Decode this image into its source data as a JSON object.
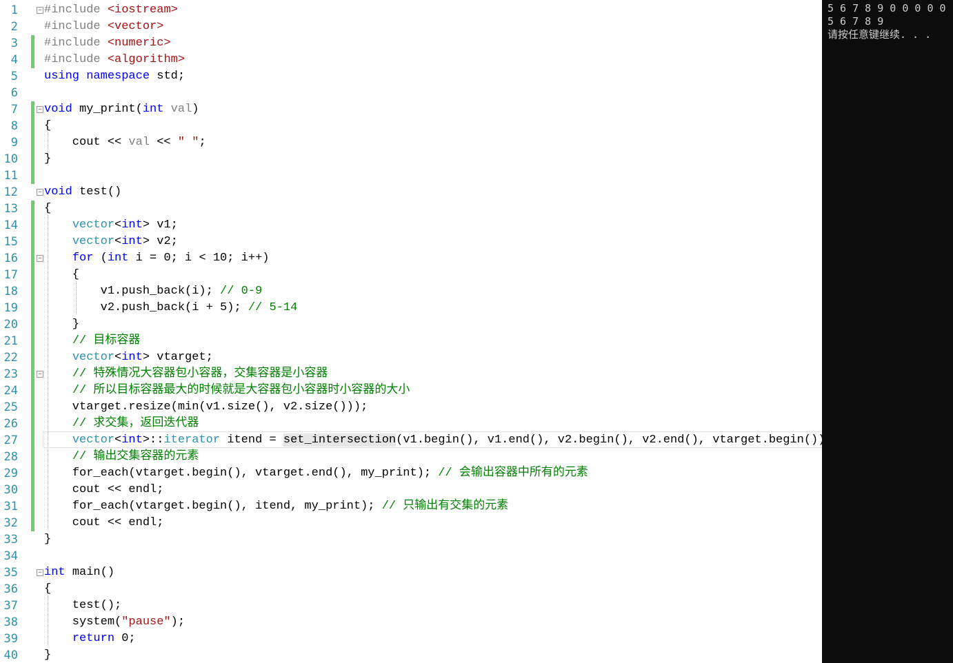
{
  "editor": {
    "lines": [
      {
        "n": "1",
        "s": [
          {
            "t": "#include ",
            "c": "inc"
          },
          {
            "t": "<iostream>",
            "c": "str"
          }
        ]
      },
      {
        "n": "2",
        "s": [
          {
            "t": "#include ",
            "c": "inc"
          },
          {
            "t": "<vector>",
            "c": "str"
          }
        ]
      },
      {
        "n": "3",
        "s": [
          {
            "t": "#include ",
            "c": "inc"
          },
          {
            "t": "<numeric>",
            "c": "str"
          }
        ]
      },
      {
        "n": "4",
        "s": [
          {
            "t": "#include ",
            "c": "inc"
          },
          {
            "t": "<algorithm>",
            "c": "str"
          }
        ]
      },
      {
        "n": "5",
        "s": [
          {
            "t": "using ",
            "c": "kw"
          },
          {
            "t": "namespace ",
            "c": "kw"
          },
          {
            "t": "std;",
            "c": ""
          }
        ]
      },
      {
        "n": "6",
        "s": []
      },
      {
        "n": "7",
        "s": [
          {
            "t": "void ",
            "c": "kw"
          },
          {
            "t": "my_print(",
            "c": ""
          },
          {
            "t": "int ",
            "c": "kw"
          },
          {
            "t": "val",
            "c": "par"
          },
          {
            "t": ")",
            "c": ""
          }
        ]
      },
      {
        "n": "8",
        "s": [
          {
            "t": "{",
            "c": ""
          }
        ]
      },
      {
        "n": "9",
        "s": [
          {
            "t": "    cout << ",
            "c": ""
          },
          {
            "t": "val",
            "c": "par"
          },
          {
            "t": " << ",
            "c": ""
          },
          {
            "t": "\" \"",
            "c": "str"
          },
          {
            "t": ";",
            "c": ""
          }
        ]
      },
      {
        "n": "10",
        "s": [
          {
            "t": "}",
            "c": ""
          }
        ]
      },
      {
        "n": "11",
        "s": []
      },
      {
        "n": "12",
        "s": [
          {
            "t": "void ",
            "c": "kw"
          },
          {
            "t": "test()",
            "c": ""
          }
        ]
      },
      {
        "n": "13",
        "s": [
          {
            "t": "{",
            "c": ""
          }
        ]
      },
      {
        "n": "14",
        "s": [
          {
            "t": "    ",
            "c": ""
          },
          {
            "t": "vector",
            "c": "ty"
          },
          {
            "t": "<",
            "c": ""
          },
          {
            "t": "int",
            "c": "kw"
          },
          {
            "t": "> v1;",
            "c": ""
          }
        ]
      },
      {
        "n": "15",
        "s": [
          {
            "t": "    ",
            "c": ""
          },
          {
            "t": "vector",
            "c": "ty"
          },
          {
            "t": "<",
            "c": ""
          },
          {
            "t": "int",
            "c": "kw"
          },
          {
            "t": "> v2;",
            "c": ""
          }
        ]
      },
      {
        "n": "16",
        "s": [
          {
            "t": "    ",
            "c": ""
          },
          {
            "t": "for ",
            "c": "kw"
          },
          {
            "t": "(",
            "c": ""
          },
          {
            "t": "int ",
            "c": "kw"
          },
          {
            "t": "i = 0; i < 10; i++)",
            "c": ""
          }
        ]
      },
      {
        "n": "17",
        "s": [
          {
            "t": "    {",
            "c": ""
          }
        ]
      },
      {
        "n": "18",
        "s": [
          {
            "t": "        v1.push_back(i); ",
            "c": ""
          },
          {
            "t": "// 0-9",
            "c": "cmt"
          }
        ]
      },
      {
        "n": "19",
        "s": [
          {
            "t": "        v2.push_back(i + 5); ",
            "c": ""
          },
          {
            "t": "// 5-14",
            "c": "cmt"
          }
        ]
      },
      {
        "n": "20",
        "s": [
          {
            "t": "    }",
            "c": ""
          }
        ]
      },
      {
        "n": "21",
        "s": [
          {
            "t": "    ",
            "c": ""
          },
          {
            "t": "// 目标容器",
            "c": "cmt"
          }
        ]
      },
      {
        "n": "22",
        "s": [
          {
            "t": "    ",
            "c": ""
          },
          {
            "t": "vector",
            "c": "ty"
          },
          {
            "t": "<",
            "c": ""
          },
          {
            "t": "int",
            "c": "kw"
          },
          {
            "t": "> vtarget;",
            "c": ""
          }
        ]
      },
      {
        "n": "23",
        "s": [
          {
            "t": "    ",
            "c": ""
          },
          {
            "t": "// 特殊情况大容器包小容器，交集容器是小容器",
            "c": "cmt"
          }
        ]
      },
      {
        "n": "24",
        "s": [
          {
            "t": "    ",
            "c": ""
          },
          {
            "t": "// 所以目标容器最大的时候就是大容器包小容器时小容器的大小",
            "c": "cmt"
          }
        ]
      },
      {
        "n": "25",
        "s": [
          {
            "t": "    vtarget.resize(min(v1.size(), v2.size()));",
            "c": ""
          }
        ]
      },
      {
        "n": "26",
        "s": [
          {
            "t": "    ",
            "c": ""
          },
          {
            "t": "// 求交集，返回迭代器",
            "c": "cmt"
          }
        ]
      },
      {
        "n": "27",
        "s": [
          {
            "t": "    ",
            "c": ""
          },
          {
            "t": "vector",
            "c": "ty"
          },
          {
            "t": "<",
            "c": ""
          },
          {
            "t": "int",
            "c": "kw"
          },
          {
            "t": ">::",
            "c": ""
          },
          {
            "t": "iterator",
            "c": "ty"
          },
          {
            "t": " itend = ",
            "c": ""
          },
          {
            "t": "set_intersection",
            "c": "hilite"
          },
          {
            "t": "(v1.begin(), v1.end(), v2.begin(), v2.end(), vtarget.begin());",
            "c": ""
          }
        ]
      },
      {
        "n": "28",
        "s": [
          {
            "t": "    ",
            "c": ""
          },
          {
            "t": "// 输出交集容器的元素",
            "c": "cmt"
          }
        ]
      },
      {
        "n": "29",
        "s": [
          {
            "t": "    for_each(vtarget.begin(), vtarget.end(), my_print); ",
            "c": ""
          },
          {
            "t": "// 会输出容器中所有的元素",
            "c": "cmt"
          }
        ]
      },
      {
        "n": "30",
        "s": [
          {
            "t": "    cout << endl;",
            "c": ""
          }
        ]
      },
      {
        "n": "31",
        "s": [
          {
            "t": "    for_each(vtarget.begin(), itend, my_print); ",
            "c": ""
          },
          {
            "t": "// 只输出有交集的元素",
            "c": "cmt"
          }
        ]
      },
      {
        "n": "32",
        "s": [
          {
            "t": "    cout << endl;",
            "c": ""
          }
        ]
      },
      {
        "n": "33",
        "s": [
          {
            "t": "}",
            "c": ""
          }
        ]
      },
      {
        "n": "34",
        "s": []
      },
      {
        "n": "35",
        "s": [
          {
            "t": "int ",
            "c": "kw"
          },
          {
            "t": "main()",
            "c": ""
          }
        ]
      },
      {
        "n": "36",
        "s": [
          {
            "t": "{",
            "c": ""
          }
        ]
      },
      {
        "n": "37",
        "s": [
          {
            "t": "    test();",
            "c": ""
          }
        ]
      },
      {
        "n": "38",
        "s": [
          {
            "t": "    system(",
            "c": ""
          },
          {
            "t": "\"pause\"",
            "c": "str"
          },
          {
            "t": ");",
            "c": ""
          }
        ]
      },
      {
        "n": "39",
        "s": [
          {
            "t": "    ",
            "c": ""
          },
          {
            "t": "return ",
            "c": "kw"
          },
          {
            "t": "0;",
            "c": ""
          }
        ]
      },
      {
        "n": "40",
        "s": [
          {
            "t": "}",
            "c": ""
          }
        ]
      }
    ]
  },
  "console": {
    "lines": [
      "5 6 7 8 9 0 0 0 0 0",
      "5 6 7 8 9",
      "请按任意键继续. . ."
    ]
  },
  "colors": {
    "editor_bg": "#ffffff",
    "console_bg": "#0c0c0c",
    "keyword": "#0000ff",
    "type": "#2b91af",
    "string": "#a31515",
    "comment": "#008000",
    "change_bar": "#6dd06d"
  }
}
